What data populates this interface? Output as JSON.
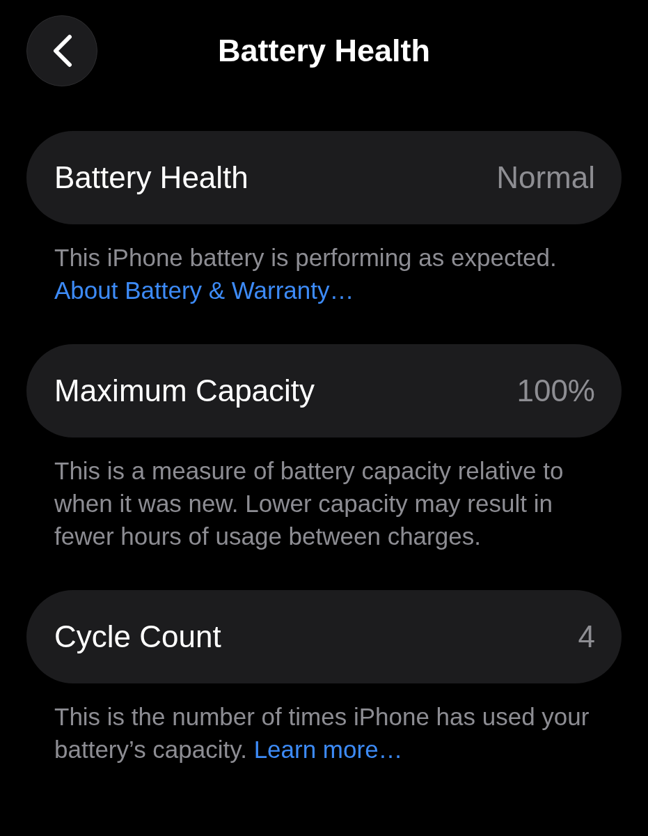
{
  "nav_bar": {
    "title": "Battery Health"
  },
  "sections": [
    {
      "label": "Battery Health",
      "value": "Normal",
      "footer": "This iPhone battery is performing as expected.",
      "link": "About Battery & Warranty…"
    },
    {
      "label": "Maximum Capacity",
      "value": "100%",
      "footer": "This is a measure of battery capacity relative to when it was new. Lower capacity may result in fewer hours of usage between charges."
    },
    {
      "label": "Cycle Count",
      "value": "4",
      "footer": "This is the number of times iPhone has used your battery’s capacity.",
      "link": "Learn more…"
    }
  ]
}
